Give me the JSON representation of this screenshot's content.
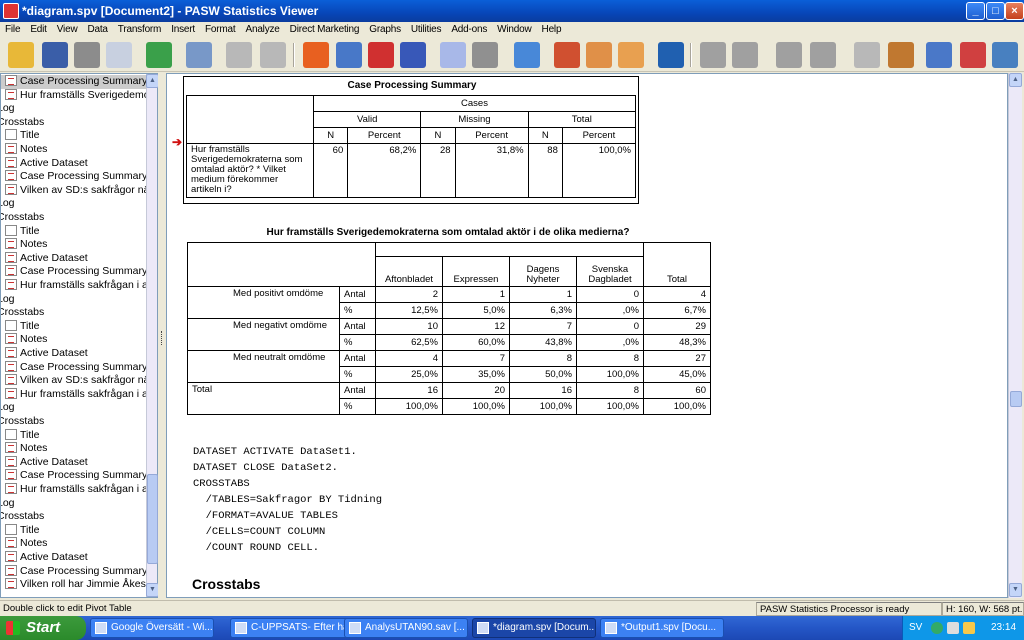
{
  "window": {
    "title": "*diagram.spv [Document2] - PASW Statistics Viewer",
    "min": "_",
    "max": "□",
    "close": "×"
  },
  "menu": [
    "File",
    "Edit",
    "View",
    "Data",
    "Transform",
    "Insert",
    "Format",
    "Analyze",
    "Direct Marketing",
    "Graphs",
    "Utilities",
    "Add-ons",
    "Window",
    "Help"
  ],
  "outline": [
    {
      "text": "Case Processing Summary",
      "icon": "table",
      "sel": true
    },
    {
      "text": "Hur framställs Sverigedemokr",
      "icon": "table"
    },
    {
      "text": "Log",
      "icon": ""
    },
    {
      "text": "Crosstabs",
      "icon": ""
    },
    {
      "text": "Title",
      "icon": "page"
    },
    {
      "text": "Notes",
      "icon": "table"
    },
    {
      "text": "Active Dataset",
      "icon": "table"
    },
    {
      "text": "Case Processing Summary",
      "icon": "table"
    },
    {
      "text": "Vilken av SD:s sakfrågor näm",
      "icon": "table"
    },
    {
      "text": "Log",
      "icon": ""
    },
    {
      "text": "Crosstabs",
      "icon": ""
    },
    {
      "text": "Title",
      "icon": "page"
    },
    {
      "text": "Notes",
      "icon": "table"
    },
    {
      "text": "Active Dataset",
      "icon": "table"
    },
    {
      "text": "Case Processing Summary",
      "icon": "table"
    },
    {
      "text": "Hur framställs sakfrågan i ar",
      "icon": "table"
    },
    {
      "text": "Log",
      "icon": ""
    },
    {
      "text": "Crosstabs",
      "icon": ""
    },
    {
      "text": "Title",
      "icon": "page"
    },
    {
      "text": "Notes",
      "icon": "table"
    },
    {
      "text": "Active Dataset",
      "icon": "table"
    },
    {
      "text": "Case Processing Summary",
      "icon": "table"
    },
    {
      "text": "Vilken av SD:s sakfrågor näm",
      "icon": "table"
    },
    {
      "text": "Hur framställs sakfrågan i ar",
      "icon": "table"
    },
    {
      "text": "Log",
      "icon": ""
    },
    {
      "text": "Crosstabs",
      "icon": ""
    },
    {
      "text": "Title",
      "icon": "page"
    },
    {
      "text": "Notes",
      "icon": "table"
    },
    {
      "text": "Active Dataset",
      "icon": "table"
    },
    {
      "text": "Case Processing Summary",
      "icon": "table"
    },
    {
      "text": "Hur framställs sakfrågan i ar",
      "icon": "table"
    },
    {
      "text": "Log",
      "icon": ""
    },
    {
      "text": "Crosstabs",
      "icon": ""
    },
    {
      "text": "Title",
      "icon": "page"
    },
    {
      "text": "Notes",
      "icon": "table"
    },
    {
      "text": "Active Dataset",
      "icon": "table"
    },
    {
      "text": "Case Processing Summary",
      "icon": "table"
    },
    {
      "text": "Vilken roll har Jimmie Åkess",
      "icon": "table"
    }
  ],
  "cps": {
    "title": "Case Processing Summary",
    "cases": "Cases",
    "groups": [
      "Valid",
      "Missing",
      "Total"
    ],
    "sub": [
      "N",
      "Percent",
      "N",
      "Percent",
      "N",
      "Percent"
    ],
    "rowlabel": "Hur framställs Sverigedemokraterna som omtalad aktör? * Vilket medium förekommer artikeln i?",
    "values": [
      "60",
      "68,2%",
      "28",
      "31,8%",
      "88",
      "100,0%"
    ]
  },
  "cross": {
    "title": "Hur framställs Sverigedemokraterna som omtalad aktör i de olika medierna?",
    "cols": [
      "Aftonbladet",
      "Expressen",
      "Dagens Nyheter",
      "Svenska Dagbladet",
      "Total"
    ],
    "rows": [
      {
        "label": "Med positivt omdöme",
        "stats": [
          {
            "s": "Antal",
            "v": [
              "2",
              "1",
              "1",
              "0",
              "4"
            ]
          },
          {
            "s": "%",
            "v": [
              "12,5%",
              "5,0%",
              "6,3%",
              ",0%",
              "6,7%"
            ]
          }
        ]
      },
      {
        "label": "Med negativt omdöme",
        "stats": [
          {
            "s": "Antal",
            "v": [
              "10",
              "12",
              "7",
              "0",
              "29"
            ]
          },
          {
            "s": "%",
            "v": [
              "62,5%",
              "60,0%",
              "43,8%",
              ",0%",
              "48,3%"
            ]
          }
        ]
      },
      {
        "label": "Med neutralt omdöme",
        "stats": [
          {
            "s": "Antal",
            "v": [
              "4",
              "7",
              "8",
              "8",
              "27"
            ]
          },
          {
            "s": "%",
            "v": [
              "25,0%",
              "35,0%",
              "50,0%",
              "100,0%",
              "45,0%"
            ]
          }
        ]
      }
    ],
    "total": {
      "label": "Total",
      "stats": [
        {
          "s": "Antal",
          "v": [
            "16",
            "20",
            "16",
            "8",
            "60"
          ]
        },
        {
          "s": "%",
          "v": [
            "100,0%",
            "100,0%",
            "100,0%",
            "100,0%",
            "100,0%"
          ]
        }
      ]
    }
  },
  "syntax": [
    "DATASET ACTIVATE DataSet1.",
    "DATASET CLOSE DataSet2.",
    "CROSSTABS",
    "  /TABLES=Sakfragor BY Tidning",
    "  /FORMAT=AVALUE TABLES",
    "  /CELLS=COUNT COLUMN",
    "  /COUNT ROUND CELL."
  ],
  "heading": "Crosstabs",
  "status": {
    "hint": "Double click to edit Pivot Table",
    "processor": "PASW Statistics Processor is ready",
    "size": "H: 160, W: 568 pt."
  },
  "taskbar": {
    "start": "Start",
    "tasks": [
      "Google Översätt - Wi...",
      "C-UPPSATS- Efter ha...",
      "AnalysUTAN90.sav [...",
      "*diagram.spv [Docum...",
      "*Output1.spv [Docu..."
    ],
    "lang": "SV",
    "clock": "23:14"
  }
}
